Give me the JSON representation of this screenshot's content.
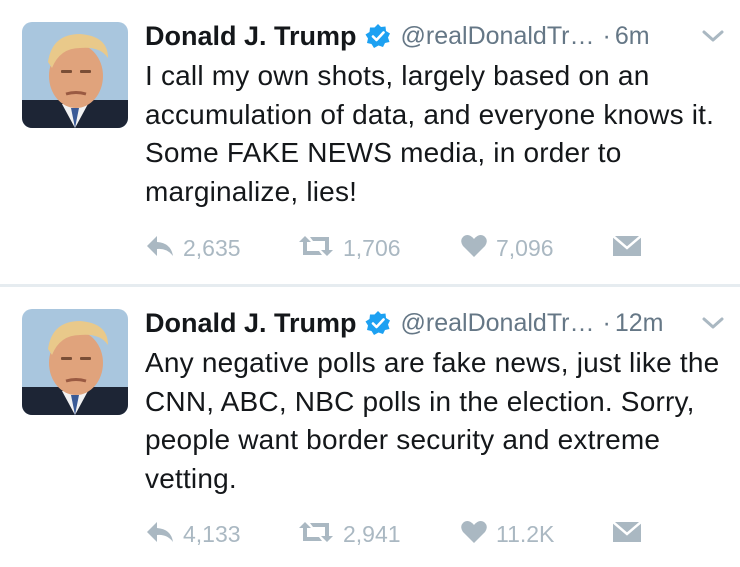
{
  "tweets": [
    {
      "author": {
        "name": "Donald J. Trump",
        "handle": "@realDonaldTr…",
        "verified": true
      },
      "time": "6m",
      "separator": "·",
      "text": "I call my own shots, largely based on an accumulation of data, and everyone knows it. Some FAKE NEWS media, in order to marginalize, lies!",
      "replies": "2,635",
      "retweets": "1,706",
      "likes": "7,096"
    },
    {
      "author": {
        "name": "Donald J. Trump",
        "handle": "@realDonaldTr…",
        "verified": true
      },
      "time": "12m",
      "separator": "·",
      "text": "Any negative polls are fake news, just like the CNN, ABC, NBC polls in the election. Sorry, people want border security and extreme vetting.",
      "replies": "4,133",
      "retweets": "2,941",
      "likes": "11.2K"
    }
  ],
  "icons": {
    "reply": "reply-icon",
    "retweet": "retweet-icon",
    "like": "heart-icon",
    "dm": "envelope-icon",
    "verified": "verified-badge-icon",
    "menu": "chevron-down-icon"
  },
  "colors": {
    "action_gray": "#aab8c2",
    "verified_blue": "#1da1f2",
    "text": "#14171a",
    "secondary": "#657786"
  }
}
